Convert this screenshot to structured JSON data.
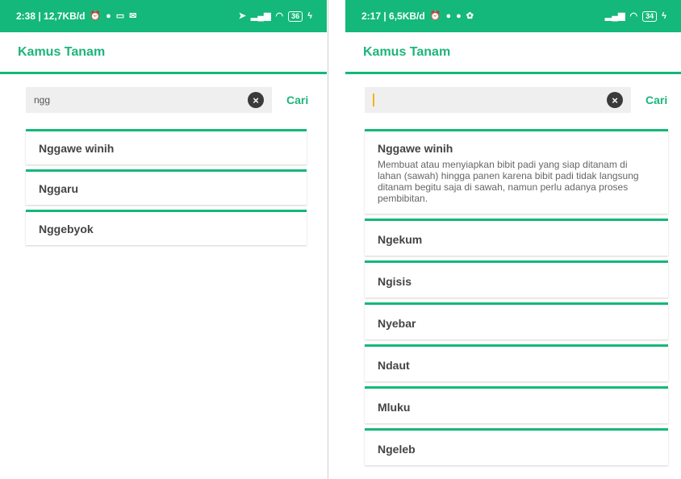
{
  "left": {
    "status": {
      "time_info": "2:38 | 12,7KB/d",
      "battery": "36"
    },
    "app_title": "Kamus Tanam",
    "search": {
      "value": "ngg",
      "button_label": "Cari"
    },
    "results": [
      {
        "name": "Nggawe winih"
      },
      {
        "name": "Nggaru"
      },
      {
        "name": "Nggebyok"
      }
    ]
  },
  "right": {
    "status": {
      "time_info": "2:17 | 6,5KB/d",
      "battery": "34"
    },
    "app_title": "Kamus Tanam",
    "search": {
      "value": "",
      "button_label": "Cari"
    },
    "results": [
      {
        "name": "Nggawe winih",
        "description": "Membuat atau menyiapkan bibit padi yang siap ditanam di lahan (sawah) hingga panen karena bibit padi tidak langsung ditanam begitu saja di sawah, namun perlu adanya proses pembibitan."
      },
      {
        "name": "Ngekum"
      },
      {
        "name": "Ngisis"
      },
      {
        "name": "Nyebar"
      },
      {
        "name": "Ndaut"
      },
      {
        "name": "Mluku"
      },
      {
        "name": "Ngeleb"
      }
    ]
  },
  "colors": {
    "accent": "#14b87a",
    "title": "#1db47c",
    "search_bg": "#efefef",
    "cursor": "#f2b705"
  },
  "icons": {
    "clear": "close-circle-icon",
    "status_left": [
      "clock-alarm-icon",
      "app-notification-icon",
      "screen-icon",
      "mail-icon"
    ],
    "status_right": [
      "location-arrow-icon",
      "signal-icon",
      "wifi-icon",
      "battery-icon",
      "charging-icon"
    ]
  }
}
